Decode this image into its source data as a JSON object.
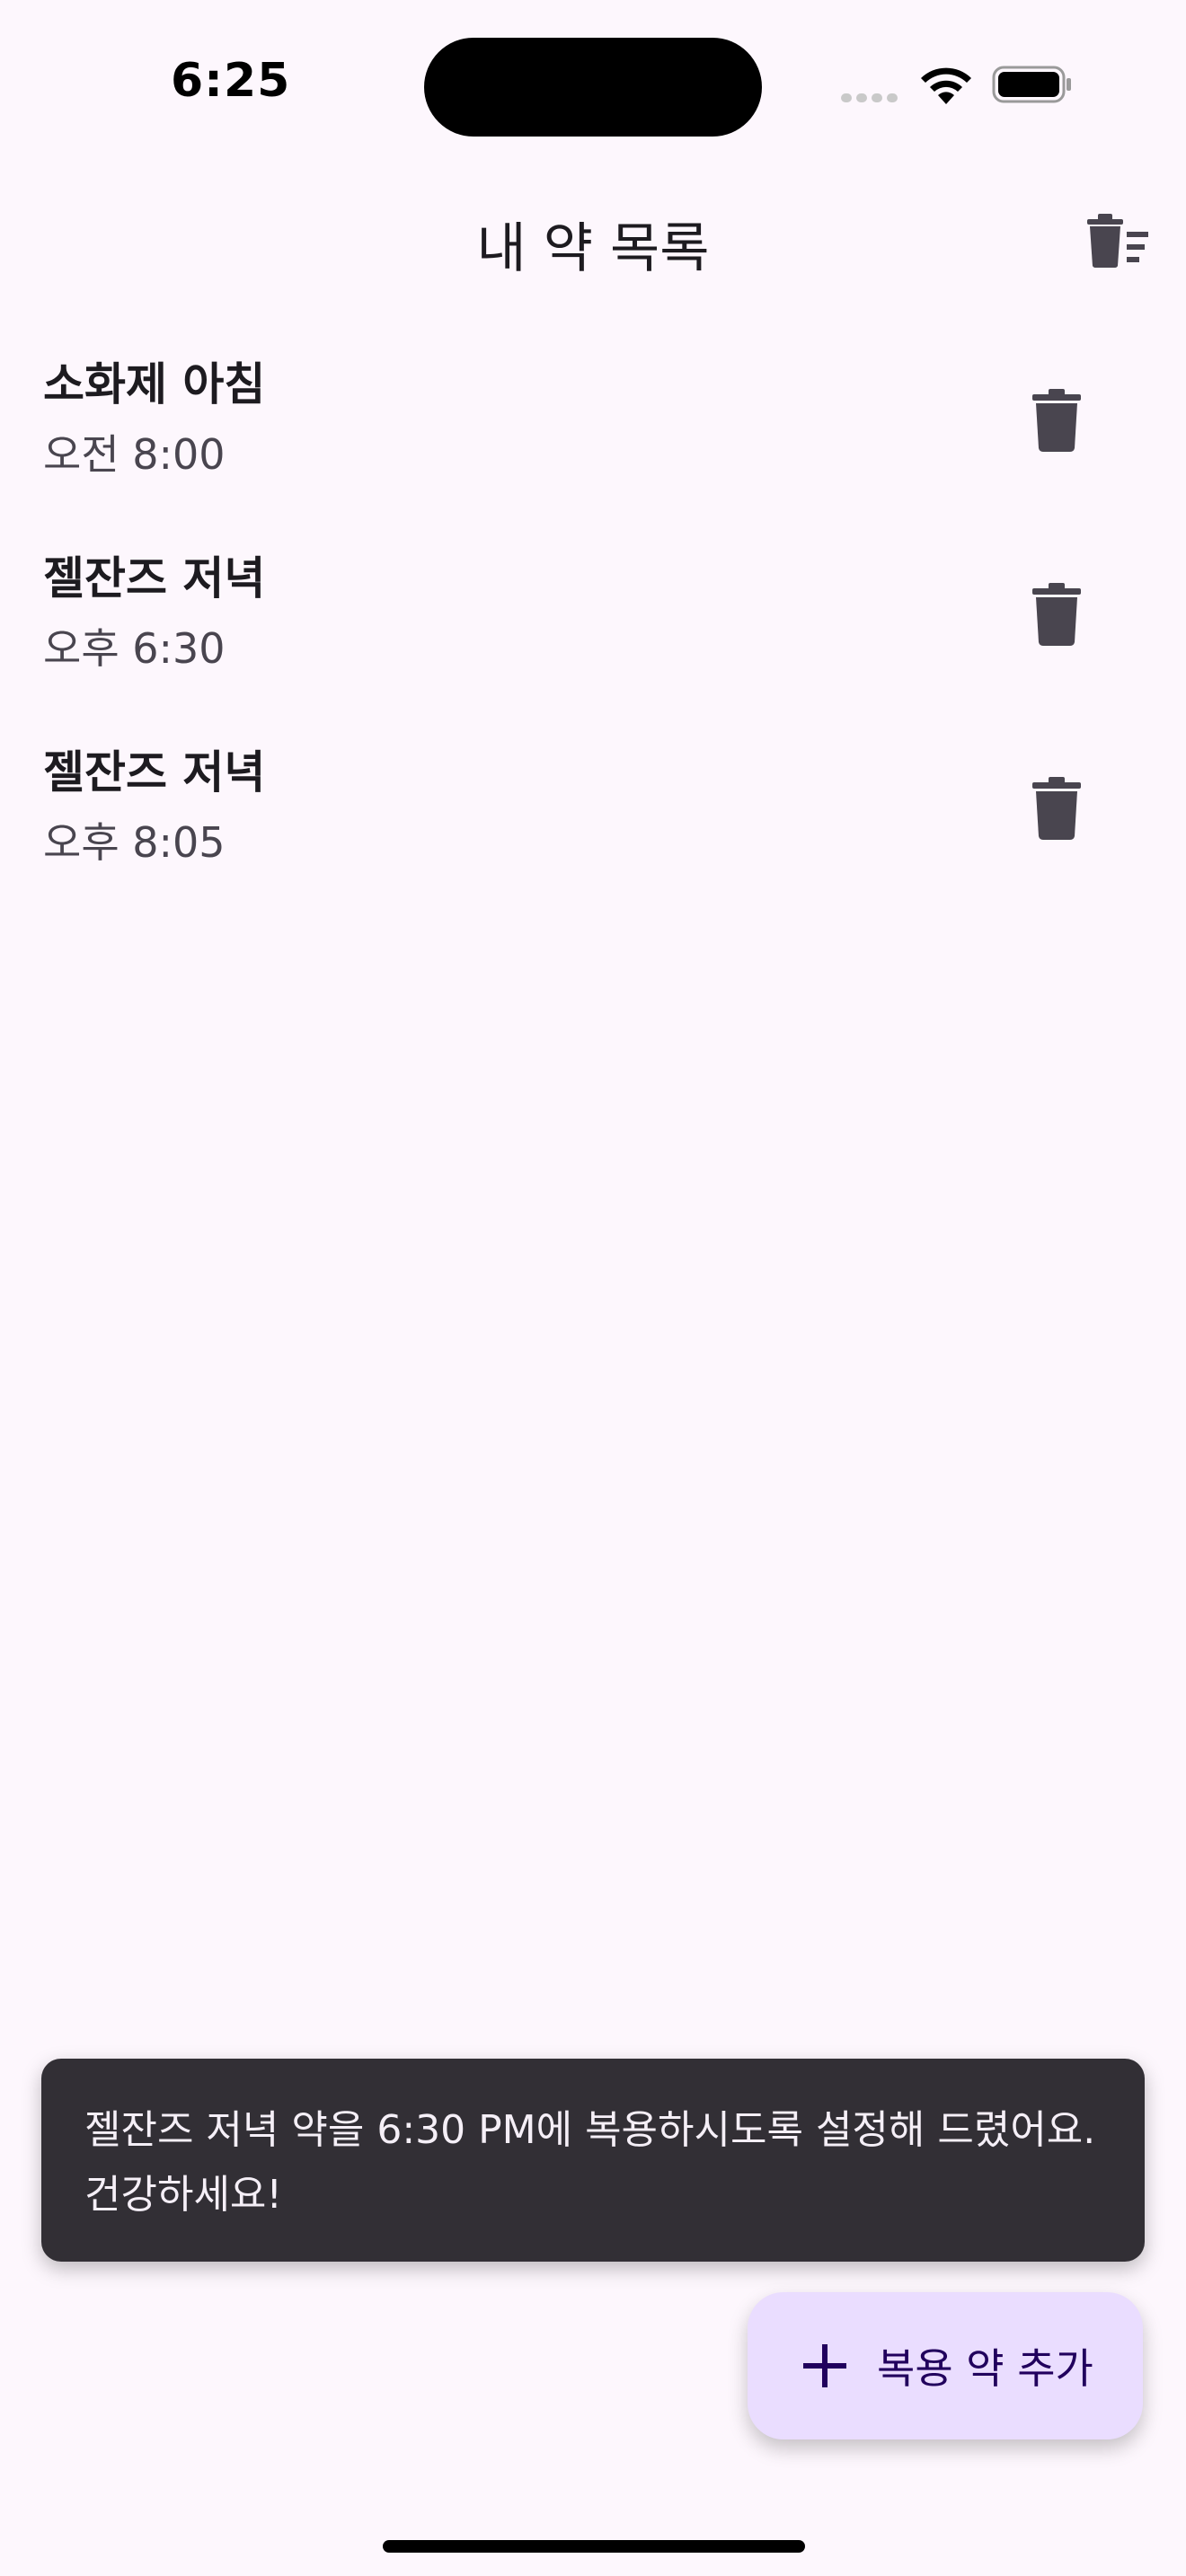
{
  "status_bar": {
    "time": "6:25"
  },
  "app_bar": {
    "title": "내 약 목록",
    "delete_all_icon": "delete-sweep-icon"
  },
  "medications": [
    {
      "name": "소화제 아침",
      "time": "오전 8:00"
    },
    {
      "name": "젤잔즈 저녁",
      "time": "오후 6:30"
    },
    {
      "name": "젤잔즈 저녁",
      "time": "오후 8:05"
    }
  ],
  "snackbar": {
    "message": "젤잔즈 저녁 약을 6:30 PM에 복용하시도록 설정해 드렸어요. 건강하세요!"
  },
  "fab": {
    "label": "복용 약 추가",
    "icon": "plus-icon"
  },
  "colors": {
    "background": "#fdf7fd",
    "snackbar_bg": "#322f35",
    "fab_bg": "#eaddff",
    "fab_text": "#21005d",
    "icon": "#49454f"
  }
}
